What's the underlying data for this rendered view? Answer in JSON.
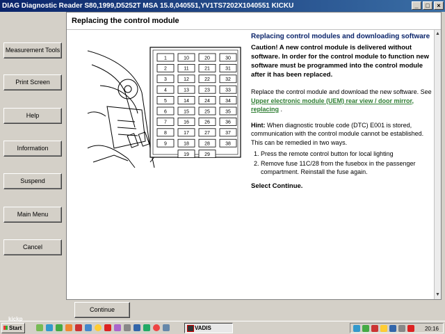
{
  "window": {
    "title": "DIAG Diagnostic Reader S80,1999,D5252T MSA 15.8,040551,YV1TS7202X1040551 KICKU",
    "controls": [
      "_",
      "□",
      "×"
    ]
  },
  "nav": [
    {
      "label": "Measurement Tools"
    },
    {
      "label": "Print Screen"
    },
    {
      "label": "Help"
    },
    {
      "label": "Information"
    },
    {
      "label": "Suspend"
    },
    {
      "label": "Main Menu"
    },
    {
      "label": "Cancel"
    }
  ],
  "page": {
    "header": "Replacing the control module",
    "heading": "Replacing control modules and downloading software",
    "caution": "Caution! A new control module is delivered without software. In order for the control module to function new software must be programmed into the control module after it has been replaced.",
    "replace_text": "Replace the control module and download the new software. See",
    "link_text": "Upper electronic module (UEM) rear view / door mirror, replacing",
    "replace_suffix": ".",
    "hint_label": "Hint:",
    "hint_text": "When diagnostic trouble code (DTC) E001 is stored, communication with the control module cannot be established. This can be remedied in two ways.",
    "steps": [
      "Press the remote control button for local lighting",
      "Remove fuse 11C/28 from the fusebox in the passenger compartment. Reinstall the fuse again."
    ],
    "select": "Select Continue."
  },
  "fuses": {
    "rows": [
      [
        "1",
        "10",
        "20",
        "30"
      ],
      [
        "2",
        "11",
        "21",
        "31"
      ],
      [
        "3",
        "12",
        "22",
        "32"
      ],
      [
        "4",
        "13",
        "23",
        "33"
      ],
      [
        "5",
        "14",
        "24",
        "34"
      ],
      [
        "6",
        "15",
        "25",
        "35"
      ],
      [
        "7",
        "16",
        "26",
        "36"
      ],
      [
        "8",
        "17",
        "27",
        "37"
      ],
      [
        "9",
        "18",
        "28",
        "38"
      ]
    ],
    "bottom": [
      "19",
      "29"
    ]
  },
  "continue_label": "Continue",
  "taskbar": {
    "start": "Start",
    "task": "VADIS",
    "clock": "20:16",
    "watermark": "kickp"
  }
}
